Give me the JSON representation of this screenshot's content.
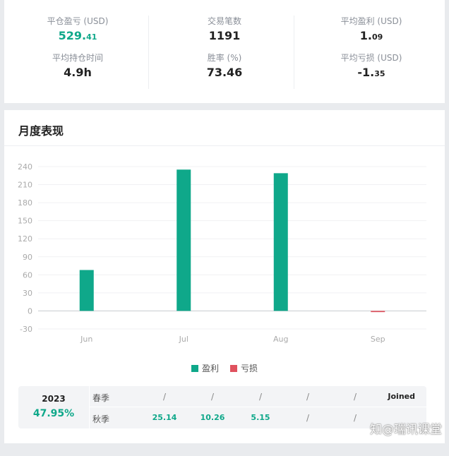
{
  "stats": [
    {
      "label": "平仓盈亏 (USD)",
      "main": "529.",
      "frac": "41",
      "green": true
    },
    {
      "label": "交易笔数",
      "main": "1191",
      "frac": "",
      "green": false
    },
    {
      "label": "平均盈利 (USD)",
      "main": "1.",
      "frac": "09",
      "green": false
    },
    {
      "label": "平均持仓时间",
      "main": "4.9h",
      "frac": "",
      "green": false
    },
    {
      "label": "胜率 (%)",
      "main": "73.46",
      "frac": "",
      "green": false
    },
    {
      "label": "平均亏损 (USD)",
      "main": "-1.",
      "frac": "35",
      "green": false
    }
  ],
  "monthly": {
    "title": "月度表现",
    "legend": {
      "profit": "盈利",
      "loss": "亏损"
    },
    "season": {
      "year": "2023",
      "pct": "47.95%",
      "rows": [
        {
          "name": "春季",
          "cells": [
            "/",
            "/",
            "/",
            "/",
            "/"
          ],
          "joined": "Joined"
        },
        {
          "name": "秋季",
          "cells": [
            "25.14",
            "10.26",
            "5.15",
            "/",
            "/"
          ],
          "joined": ""
        }
      ]
    }
  },
  "chart_data": {
    "type": "bar",
    "categories": [
      "Jun",
      "Jul",
      "Aug",
      "Sep"
    ],
    "series": [
      {
        "values": [
          68,
          235,
          229,
          -2
        ]
      }
    ],
    "ylim": [
      -30,
      240
    ],
    "yticks": [
      -30,
      0,
      30,
      60,
      90,
      120,
      150,
      180,
      210,
      240
    ],
    "colors": {
      "profit": "#0fa88a",
      "loss": "#e0525e"
    },
    "grid": true
  },
  "watermark": "知@瑞讯课堂"
}
